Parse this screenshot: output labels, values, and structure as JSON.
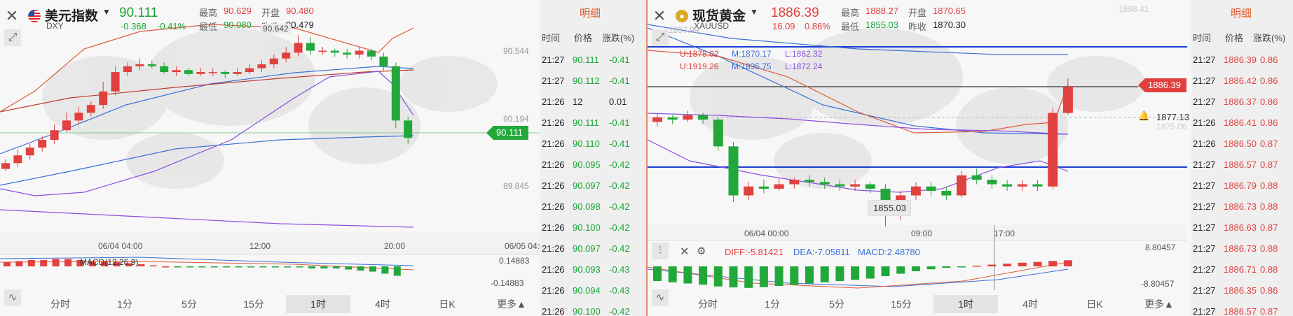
{
  "colors": {
    "up": "#e0413e",
    "down": "#22a83a",
    "accent": "#e25a2a"
  },
  "left": {
    "name": "美元指数",
    "code": "DXY",
    "price": "90.111",
    "change": "-0.368",
    "change_pct": "-0.41%",
    "high_label": "最高",
    "high": "90.629",
    "low_label": "最低",
    "low": "90.080",
    "open_label": "开盘",
    "open": "90.480",
    "prev_label": "昨收",
    "prev": "90.479",
    "peak_label": "90.642",
    "y_labels": [
      "90.544",
      "90.194",
      "89.845"
    ],
    "current_tag": "90.111",
    "x_labels": [
      "06/04 04:00",
      "12:00",
      "20:00",
      "06/05 04:00"
    ],
    "macd_label": "MACD(12,26,9)",
    "macd_top": "0.14883",
    "macd_bottom": "-0.14883",
    "tabs": [
      "分时",
      "1分",
      "5分",
      "15分",
      "1时",
      "4时",
      "日K",
      "更多▲"
    ],
    "candles": [
      {
        "o": 89.95,
        "c": 89.98,
        "h": 90.0,
        "l": 89.94
      },
      {
        "o": 89.98,
        "c": 90.02,
        "h": 90.05,
        "l": 89.96
      },
      {
        "o": 90.02,
        "c": 90.06,
        "h": 90.08,
        "l": 90.0
      },
      {
        "o": 90.06,
        "c": 90.1,
        "h": 90.12,
        "l": 90.04
      },
      {
        "o": 90.1,
        "c": 90.15,
        "h": 90.18,
        "l": 90.08
      },
      {
        "o": 90.15,
        "c": 90.2,
        "h": 90.24,
        "l": 90.14
      },
      {
        "o": 90.2,
        "c": 90.24,
        "h": 90.27,
        "l": 90.18
      },
      {
        "o": 90.24,
        "c": 90.28,
        "h": 90.3,
        "l": 90.22
      },
      {
        "o": 90.28,
        "c": 90.35,
        "h": 90.4,
        "l": 90.26
      },
      {
        "o": 90.35,
        "c": 90.45,
        "h": 90.48,
        "l": 90.33
      },
      {
        "o": 90.45,
        "c": 90.48,
        "h": 90.5,
        "l": 90.43
      },
      {
        "o": 90.48,
        "c": 90.49,
        "h": 90.52,
        "l": 90.46
      },
      {
        "o": 90.49,
        "c": 90.48,
        "h": 90.51,
        "l": 90.47
      },
      {
        "o": 90.48,
        "c": 90.45,
        "h": 90.5,
        "l": 90.44
      },
      {
        "o": 90.45,
        "c": 90.46,
        "h": 90.48,
        "l": 90.43
      },
      {
        "o": 90.46,
        "c": 90.44,
        "h": 90.47,
        "l": 90.43
      },
      {
        "o": 90.44,
        "c": 90.45,
        "h": 90.47,
        "l": 90.43
      },
      {
        "o": 90.45,
        "c": 90.45,
        "h": 90.47,
        "l": 90.43
      },
      {
        "o": 90.45,
        "c": 90.44,
        "h": 90.46,
        "l": 90.42
      },
      {
        "o": 90.44,
        "c": 90.45,
        "h": 90.47,
        "l": 90.43
      },
      {
        "o": 90.45,
        "c": 90.47,
        "h": 90.49,
        "l": 90.44
      },
      {
        "o": 90.47,
        "c": 90.49,
        "h": 90.51,
        "l": 90.45
      },
      {
        "o": 90.49,
        "c": 90.52,
        "h": 90.54,
        "l": 90.47
      },
      {
        "o": 90.52,
        "c": 90.55,
        "h": 90.58,
        "l": 90.5
      },
      {
        "o": 90.55,
        "c": 90.6,
        "h": 90.64,
        "l": 90.53
      },
      {
        "o": 90.6,
        "c": 90.56,
        "h": 90.63,
        "l": 90.54
      },
      {
        "o": 90.56,
        "c": 90.56,
        "h": 90.58,
        "l": 90.54
      },
      {
        "o": 90.56,
        "c": 90.55,
        "h": 90.57,
        "l": 90.53
      },
      {
        "o": 90.55,
        "c": 90.54,
        "h": 90.57,
        "l": 90.52
      },
      {
        "o": 90.54,
        "c": 90.56,
        "h": 90.58,
        "l": 90.52
      },
      {
        "o": 90.56,
        "c": 90.53,
        "h": 90.57,
        "l": 90.51
      },
      {
        "o": 90.53,
        "c": 90.48,
        "h": 90.55,
        "l": 90.46
      },
      {
        "o": 90.48,
        "c": 90.2,
        "h": 90.5,
        "l": 90.16
      },
      {
        "o": 90.2,
        "c": 90.11,
        "h": 90.22,
        "l": 90.08
      }
    ],
    "macd_hist": [
      0.04,
      0.05,
      0.06,
      0.06,
      0.07,
      0.07,
      0.06,
      0.05,
      0.05,
      0.04,
      0.03,
      0.02,
      0.01,
      0.0,
      -0.01,
      -0.01,
      -0.01,
      -0.01,
      -0.01,
      -0.01,
      -0.01,
      -0.01,
      -0.01,
      -0.01,
      -0.01,
      -0.02,
      -0.02,
      -0.02,
      -0.03,
      -0.04,
      -0.05,
      -0.07,
      -0.09
    ],
    "ticks": [
      [
        "21:27",
        "90.111",
        "-0.41"
      ],
      [
        "21:27",
        "90.112",
        "-0.41"
      ],
      [
        "21:26",
        "12",
        "0.01"
      ],
      [
        "21:26",
        "90.111",
        "-0.41"
      ],
      [
        "21:26",
        "90.110",
        "-0.41"
      ],
      [
        "21:26",
        "90.095",
        "-0.42"
      ],
      [
        "21:26",
        "90.097",
        "-0.42"
      ],
      [
        "21:26",
        "90.098",
        "-0.42"
      ],
      [
        "21:26",
        "90.100",
        "-0.42"
      ],
      [
        "21:26",
        "90.097",
        "-0.42"
      ],
      [
        "21:26",
        "90.093",
        "-0.43"
      ],
      [
        "21:26",
        "90.094",
        "-0.43"
      ],
      [
        "21:26",
        "90.100",
        "-0.42"
      ]
    ]
  },
  "right": {
    "name": "现货黄金",
    "code": "XAUUSD",
    "price": "1886.39",
    "change": "16.09",
    "change_pct": "0.86%",
    "high_label": "最高",
    "high": "1888.27",
    "low_label": "最低",
    "low": "1855.03",
    "open_label": "开盘",
    "open": "1870.65",
    "prev_label": "昨收",
    "prev": "1870.30",
    "boll_u": "U:1878.02",
    "boll_m": "M:1870.17",
    "boll_l": "L:1862.32",
    "boll2_u": "U:1919.26",
    "boll2_m": "M:1895.75",
    "boll2_l": "L:1872.24",
    "faded_high": "1897.99",
    "faded_top": "1898.41",
    "faded_mid": "1875.06",
    "low_marker": "1855.03",
    "current_tag": "1886.39",
    "alert_price": "1877.13",
    "x_labels": [
      "06/04 00:00",
      "09:00",
      "17:00"
    ],
    "diff": "DIFF:-5.81421",
    "dea": "DEA:-7.05811",
    "macd": "MACD:2.48780",
    "macd_top": "8.80457",
    "macd_bottom": "-8.80457",
    "tabs": [
      "分时",
      "1分",
      "5分",
      "15分",
      "1时",
      "4时",
      "日K",
      "更多▲"
    ],
    "candles": [
      {
        "o": 1878.5,
        "c": 1879.5,
        "h": 1880.5,
        "l": 1877.5
      },
      {
        "o": 1879.5,
        "c": 1879.0,
        "h": 1880.0,
        "l": 1878.0
      },
      {
        "o": 1879.0,
        "c": 1880.0,
        "h": 1881.0,
        "l": 1878.5
      },
      {
        "o": 1880.0,
        "c": 1879.0,
        "h": 1880.5,
        "l": 1878.0
      },
      {
        "o": 1879.0,
        "c": 1873.0,
        "h": 1879.5,
        "l": 1872.0
      },
      {
        "o": 1873.0,
        "c": 1862.0,
        "h": 1874.0,
        "l": 1860.5
      },
      {
        "o": 1862.0,
        "c": 1864.0,
        "h": 1865.0,
        "l": 1861.0
      },
      {
        "o": 1864.0,
        "c": 1863.5,
        "h": 1865.5,
        "l": 1862.5
      },
      {
        "o": 1863.5,
        "c": 1864.5,
        "h": 1866.0,
        "l": 1863.0
      },
      {
        "o": 1864.5,
        "c": 1865.5,
        "h": 1866.0,
        "l": 1863.5
      },
      {
        "o": 1865.5,
        "c": 1865.0,
        "h": 1866.5,
        "l": 1864.0
      },
      {
        "o": 1865.0,
        "c": 1864.5,
        "h": 1866.0,
        "l": 1863.5
      },
      {
        "o": 1864.5,
        "c": 1864.0,
        "h": 1865.5,
        "l": 1863.0
      },
      {
        "o": 1864.0,
        "c": 1864.5,
        "h": 1865.5,
        "l": 1863.0
      },
      {
        "o": 1864.5,
        "c": 1863.5,
        "h": 1865.0,
        "l": 1862.5
      },
      {
        "o": 1863.5,
        "c": 1857.5,
        "h": 1864.5,
        "l": 1855.03
      },
      {
        "o": 1857.5,
        "c": 1862.0,
        "h": 1863.0,
        "l": 1856.5
      },
      {
        "o": 1862.0,
        "c": 1864.0,
        "h": 1865.0,
        "l": 1861.0
      },
      {
        "o": 1864.0,
        "c": 1863.0,
        "h": 1865.0,
        "l": 1862.0
      },
      {
        "o": 1863.0,
        "c": 1862.0,
        "h": 1864.0,
        "l": 1861.0
      },
      {
        "o": 1862.0,
        "c": 1866.5,
        "h": 1867.5,
        "l": 1861.5
      },
      {
        "o": 1866.5,
        "c": 1865.5,
        "h": 1868.0,
        "l": 1864.5
      },
      {
        "o": 1865.5,
        "c": 1864.5,
        "h": 1866.5,
        "l": 1863.5
      },
      {
        "o": 1864.5,
        "c": 1864.0,
        "h": 1865.5,
        "l": 1863.0
      },
      {
        "o": 1864.0,
        "c": 1864.5,
        "h": 1865.5,
        "l": 1863.0
      },
      {
        "o": 1864.5,
        "c": 1864.0,
        "h": 1865.5,
        "l": 1863.0
      },
      {
        "o": 1864.0,
        "c": 1880.5,
        "h": 1881.5,
        "l": 1863.5
      },
      {
        "o": 1880.5,
        "c": 1886.39,
        "h": 1888.27,
        "l": 1880.0
      }
    ],
    "macd_hist": [
      -6.0,
      -6.5,
      -7.0,
      -7.5,
      -8.2,
      -8.6,
      -8.8,
      -8.5,
      -8.0,
      -7.5,
      -7.0,
      -6.5,
      -6.0,
      -5.5,
      -5.0,
      -4.0,
      -3.0,
      -2.0,
      -1.2,
      -0.6,
      -0.2,
      0.3,
      0.7,
      1.1,
      1.5,
      1.8,
      2.2,
      2.48
    ],
    "ticks": [
      [
        "21:27",
        "1886.39",
        "0.86"
      ],
      [
        "21:27",
        "1886.42",
        "0.86"
      ],
      [
        "21:27",
        "1886.37",
        "0.86"
      ],
      [
        "21:26",
        "1886.41",
        "0.86"
      ],
      [
        "21:26",
        "1886.50",
        "0.87"
      ],
      [
        "21:27",
        "1886.57",
        "0.87"
      ],
      [
        "21:27",
        "1886.79",
        "0.88"
      ],
      [
        "21:27",
        "1886.73",
        "0.88"
      ],
      [
        "21:27",
        "1886.63",
        "0.87"
      ],
      [
        "21:27",
        "1886.73",
        "0.88"
      ],
      [
        "21:27",
        "1886.71",
        "0.88"
      ],
      [
        "21:27",
        "1886.35",
        "0.86"
      ],
      [
        "21:27",
        "1886.57",
        "0.87"
      ]
    ]
  },
  "side": {
    "tab": "明细",
    "head_time": "时间",
    "head_price": "价格",
    "head_pct": "涨跌(%)"
  }
}
